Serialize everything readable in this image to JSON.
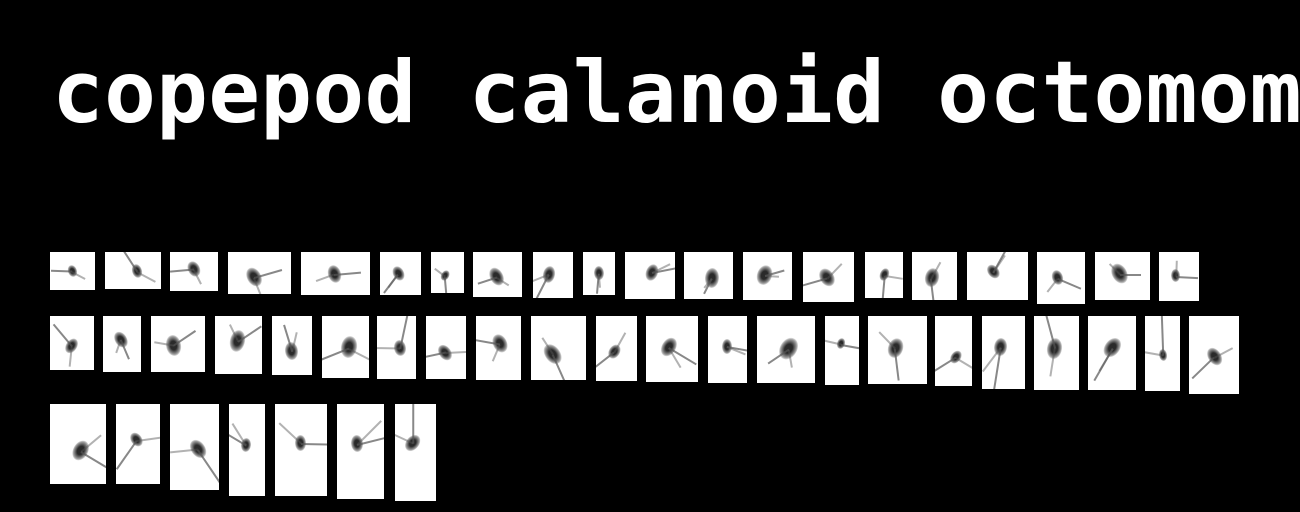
{
  "title": "copepod calanoid octomoms",
  "gallery": {
    "label": "specimen image thumbnails",
    "ink_color": "#2a2a2a",
    "background_color": "#ffffff"
  }
}
